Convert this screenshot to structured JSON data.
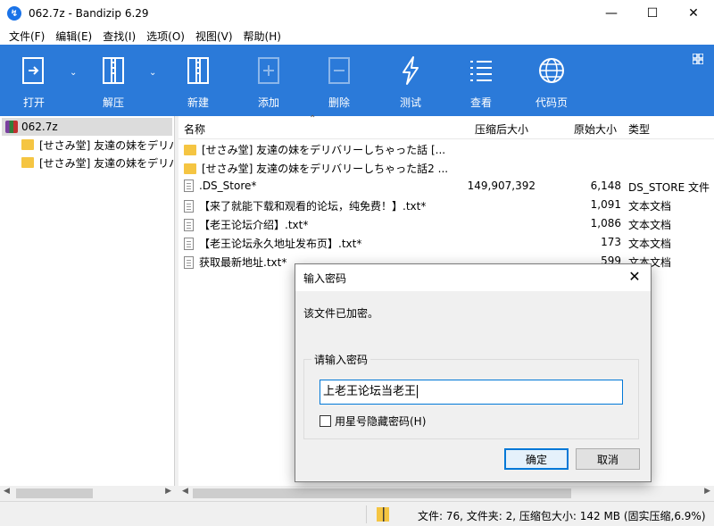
{
  "window": {
    "title": "062.7z - Bandizip 6.29",
    "app_icon": "bandizip-icon",
    "controls": {
      "minimize": "—",
      "maximize": "☐",
      "close": "✕"
    }
  },
  "menu": [
    "文件(F)",
    "编辑(E)",
    "查找(I)",
    "选项(O)",
    "视图(V)",
    "帮助(H)"
  ],
  "toolbar": {
    "open": "打开",
    "extract": "解压",
    "new": "新建",
    "add": "添加",
    "delete": "删除",
    "test": "测试",
    "view": "查看",
    "codepage": "代码页"
  },
  "tree": {
    "root": "062.7z",
    "children": [
      "[せさみ堂] 友達の妹をデリバ",
      "[せさみ堂] 友達の妹をデリバ"
    ]
  },
  "list": {
    "headers": {
      "name": "名称",
      "packed": "压缩后大小",
      "original": "原始大小",
      "type": "类型"
    },
    "rows": [
      {
        "name": "[せさみ堂] 友達の妹をデリバリーしちゃった話 [...",
        "icon": "folder-icon",
        "packed": "",
        "original": "",
        "type": ""
      },
      {
        "name": "[せさみ堂] 友達の妹をデリバリーしちゃった話2 ...",
        "icon": "folder-icon",
        "packed": "",
        "original": "",
        "type": ""
      },
      {
        "name": ".DS_Store*",
        "icon": "file-icon",
        "packed": "149,907,392",
        "original": "6,148",
        "type": "DS_STORE 文件"
      },
      {
        "name": "【来了就能下载和观看的论坛，纯免费！】.txt*",
        "icon": "file-icon",
        "packed": "",
        "original": "1,091",
        "type": "文本文档"
      },
      {
        "name": "【老王论坛介绍】.txt*",
        "icon": "file-icon",
        "packed": "",
        "original": "1,086",
        "type": "文本文档"
      },
      {
        "name": "【老王论坛永久地址发布页】.txt*",
        "icon": "file-icon",
        "packed": "",
        "original": "173",
        "type": "文本文档"
      },
      {
        "name": "获取最新地址.txt*",
        "icon": "file-icon",
        "packed": "",
        "original": "599",
        "type": "文本文档"
      }
    ]
  },
  "status": {
    "summary": "文件: 76, 文件夹: 2, 压缩包大小: 142 MB (固实压缩,6.9%)"
  },
  "dialog": {
    "title": "输入密码",
    "message": "该文件已加密。",
    "group_label": "请输入密码",
    "password_value": "上老王论坛当老王",
    "checkbox_label": "用星号隐藏密码(H)",
    "checkbox_checked": false,
    "ok": "确定",
    "cancel": "取消"
  },
  "colors": {
    "toolbar_bg": "#2b7ad9",
    "focus_blue": "#0078d7"
  }
}
